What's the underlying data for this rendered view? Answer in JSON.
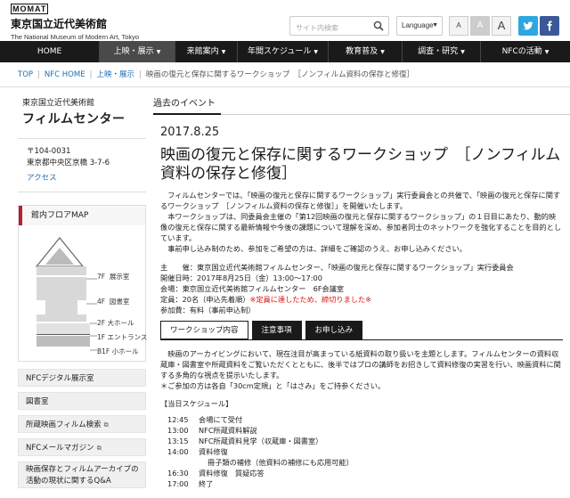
{
  "header": {
    "logo_mark": "MOMAT",
    "logo_jp": "東京国立近代美術館",
    "logo_en": "The National Museum of Modern Art, Tokyo",
    "search_placeholder": "サイト内検索",
    "language_label": "Language",
    "font_size_labels": [
      "A",
      "A",
      "A"
    ],
    "sns_icons": [
      "twitter-icon",
      "facebook-icon"
    ],
    "colors": {
      "twitter": "#2ea7e0",
      "facebook": "#3b5998",
      "nav_bg": "#1a1a1a",
      "accent": "#b0223a",
      "link": "#1e6fb8",
      "alert": "#dd1111"
    }
  },
  "nav": {
    "items": [
      {
        "label": "HOME",
        "dropdown": false
      },
      {
        "label": "上映・展示",
        "dropdown": true,
        "active": true
      },
      {
        "label": "来館案内",
        "dropdown": true
      },
      {
        "label": "年間スケジュール",
        "dropdown": true
      },
      {
        "label": "教育普及",
        "dropdown": true
      },
      {
        "label": "調査・研究",
        "dropdown": true
      },
      {
        "label": "NFCの活動",
        "dropdown": true
      }
    ]
  },
  "breadcrumb": [
    "TOP",
    "NFC HOME",
    "上映・展示",
    "映画の復元と保存に関するワークショップ　［ノンフィルム資料の保存と修復］"
  ],
  "sidebar": {
    "sub": "東京国立近代美術館",
    "title": "フィルムセンター",
    "postal": "〒104-0031",
    "address": "東京都中央区京橋 3-7-6",
    "access": "アクセス",
    "map_heading": "館内フロアMAP",
    "floors": [
      {
        "floor": "7F",
        "name": "展示室"
      },
      {
        "floor": "4F",
        "name": "図書室"
      },
      {
        "floor": "2F",
        "name": "大ホール"
      },
      {
        "floor": "1F",
        "name": "エントランス"
      },
      {
        "floor": "B1F",
        "name": "小ホール"
      }
    ],
    "links": [
      {
        "label": "NFCデジタル展示室",
        "external": false
      },
      {
        "label": "図書室",
        "external": false
      },
      {
        "label": "所蔵映画フィルム検索",
        "external": true
      },
      {
        "label": "NFCメールマガジン",
        "external": true
      },
      {
        "label": "映画保存とフィルムアーカイブの活動の現状に関するQ&A",
        "external": false
      }
    ]
  },
  "main": {
    "section_tab": "過去のイベント",
    "date": "2017.8.25",
    "title": "映画の復元と保存に関するワークショップ　［ノンフィルム資料の保存と修復］",
    "intro": [
      "フィルムセンターでは、「映画の復元と保存に関するワークショップ」実行委員会との共催で、「映画の復元と保存に関するワークショップ　［ノンフィルム資料の保存と修復］」を開催いたします。",
      "本ワークショップは、同委員会主催の「第12回映画の復元と保存に関するワークショップ」の１日目にあたり、動的映像の復元と保存に関する最新情報や今後の課題について理解を深め、参加者同士のネットワークを強化することを目的としています。",
      "事前申し込み制のため、参加をご希望の方は、詳細をご確認のうえ、お申し込みください。"
    ],
    "info": {
      "host": "主　　催：東京国立近代美術館フィルムセンター、「映画の復元と保存に関するワークショップ」実行委員会",
      "datetime": "開催日時：2017年8月25日（金）13:00～17:00",
      "venue": "会場：東京国立近代美術館フィルムセンター　6F会議室",
      "capacity": "定員：20名（申込先着順）",
      "capacity_alert": "※定員に達したため、締切りました※",
      "fee": "参加費：有料（事前申込制）"
    },
    "tabs": [
      "ワークショップ内容",
      "注意事項",
      "お申し込み"
    ],
    "content": [
      "映画のアーカイビングにおいて、現在注目が高まっている紙資料の取り扱いを主題とします。フィルムセンターの資料収蔵庫・図書室や所蔵資料をご覧いただくとともに、後半ではプロの講師をお招きして資料修復の実習を行い、映画資料に関する多角的な視点を提示いたします。",
      "＊ご参加の方は各自「30cm定規」と「はさみ」をご持参ください。"
    ],
    "schedule_heading": "【当日スケジュール】",
    "schedule": [
      {
        "time": "12:45",
        "desc": "会場にて受付"
      },
      {
        "time": "13:00",
        "desc": "NFC所蔵資料解説"
      },
      {
        "time": "13:15",
        "desc": "NFC所蔵資料見学（収蔵庫・図書室）"
      },
      {
        "time": "14:00",
        "desc": "資料修復"
      },
      {
        "time": "",
        "desc": "冊子類の補修（他資料の補修にも応用可能）"
      },
      {
        "time": "16:30",
        "desc": "資料修復　質疑応答"
      },
      {
        "time": "17:00",
        "desc": "終了"
      }
    ]
  }
}
